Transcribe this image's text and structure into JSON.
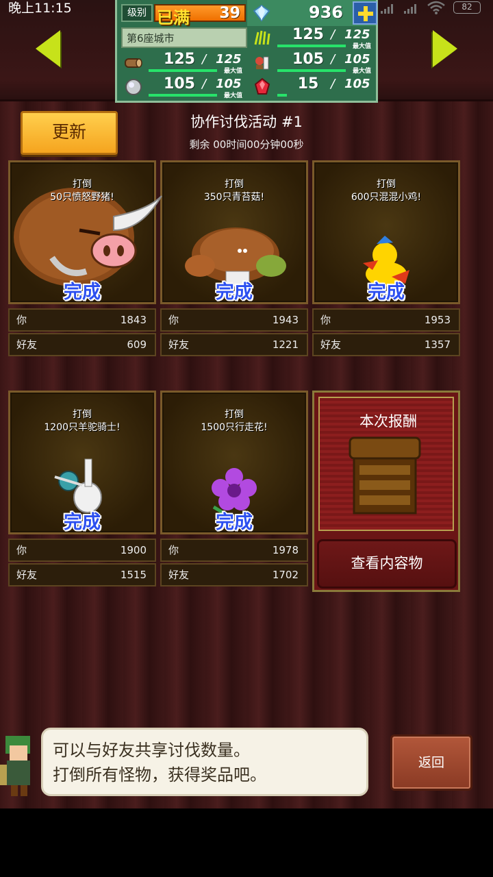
{
  "status_bar": {
    "time": "晚上11:15",
    "battery": "82"
  },
  "stats": {
    "level_label": "级别",
    "level_status": "已满",
    "level_value": "39",
    "gems": "936",
    "city": "第6座城市",
    "wood": {
      "value": "125",
      "max": "125",
      "cap_label": "最大值"
    },
    "grass": {
      "value": "125",
      "max": "125",
      "cap_label": "最大值"
    },
    "ore": {
      "value": "105",
      "max": "105",
      "cap_label": "最大值"
    },
    "food": {
      "value": "105",
      "max": "105",
      "cap_label": "最大值"
    },
    "ruby": {
      "value": "15",
      "max": "105"
    }
  },
  "header": {
    "refresh_label": "更新",
    "title": "协作讨伐活动 #1",
    "remaining": "剩余 00时间00分钟00秒"
  },
  "cards": [
    {
      "line1": "打倒",
      "line2": "50只愤怒野猪!",
      "done": "完成",
      "you_label": "你",
      "you": "1843",
      "friend_label": "好友",
      "friend": "609"
    },
    {
      "line1": "打倒",
      "line2": "350只青苔菇!",
      "done": "完成",
      "you_label": "你",
      "you": "1943",
      "friend_label": "好友",
      "friend": "1221"
    },
    {
      "line1": "打倒",
      "line2": "600只混混小鸡!",
      "done": "完成",
      "you_label": "你",
      "you": "1953",
      "friend_label": "好友",
      "friend": "1357"
    },
    {
      "line1": "打倒",
      "line2": "1200只羊驼骑士!",
      "done": "完成",
      "you_label": "你",
      "you": "1900",
      "friend_label": "好友",
      "friend": "1515"
    },
    {
      "line1": "打倒",
      "line2": "1500只行走花!",
      "done": "完成",
      "you_label": "你",
      "you": "1978",
      "friend_label": "好友",
      "friend": "1702"
    }
  ],
  "reward": {
    "title": "本次报酬",
    "view_label": "查看内容物"
  },
  "dialog": {
    "line1": "可以与好友共享讨伐数量。",
    "line2": "打倒所有怪物，获得奖品吧。"
  },
  "back_label": "返回",
  "colors": {
    "accent_green": "#c7e21a",
    "done_blue": "#2b4ff0",
    "refresh_orange": "#f5a41f"
  }
}
